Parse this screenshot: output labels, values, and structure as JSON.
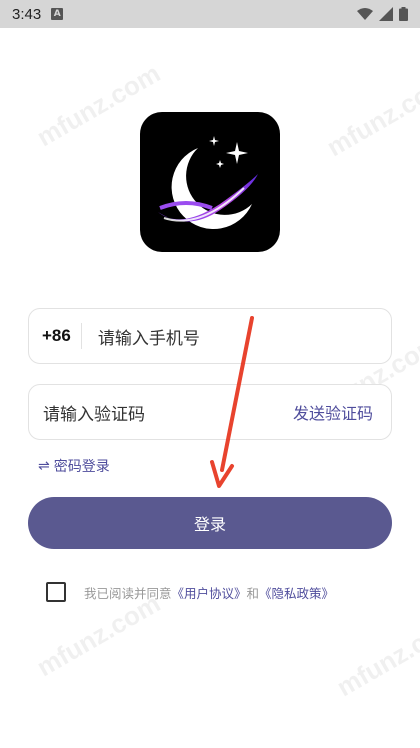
{
  "status_bar": {
    "time": "3:43",
    "notif_icon": "A"
  },
  "watermark": "mfunz.com",
  "login": {
    "country_code": "+86",
    "phone_placeholder": "请输入手机号",
    "code_placeholder": "请输入验证码",
    "send_code_label": "发送验证码",
    "switch_label": "密码登录",
    "login_button": "登录"
  },
  "agreement": {
    "prefix": "我已阅读并同意",
    "user_agreement": "《用户协议》",
    "and": "和",
    "privacy_policy": "《隐私政策》"
  },
  "colors": {
    "accent": "#4f4d9c",
    "button": "#5a5990",
    "annotation_arrow": "#e8432e"
  }
}
